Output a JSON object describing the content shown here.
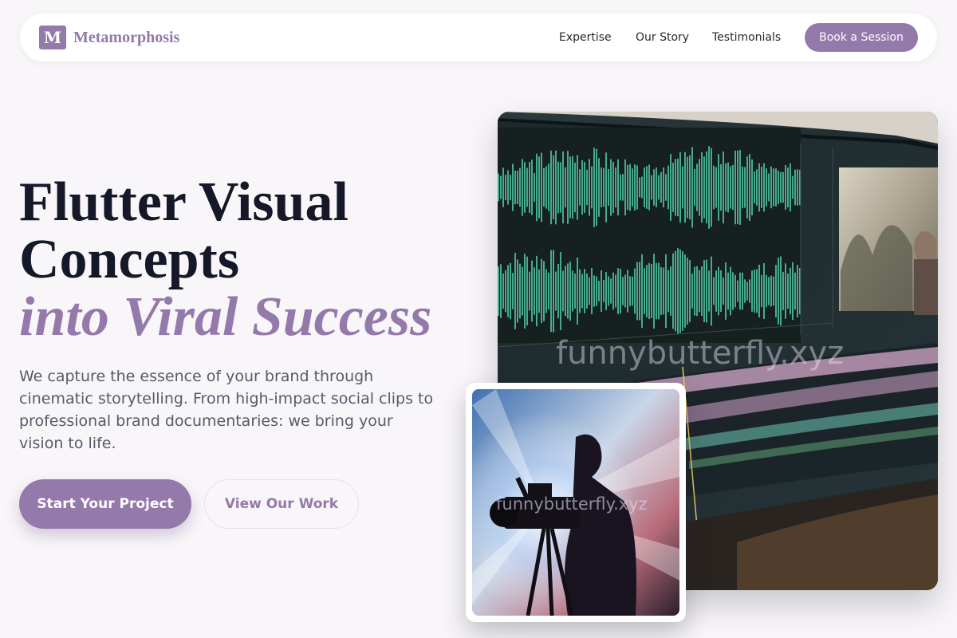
{
  "brand": {
    "logo_letter": "M",
    "name": "Metamorphosis",
    "accent_color": "#9479ab"
  },
  "nav": {
    "links": [
      "Expertise",
      "Our Story",
      "Testimonials"
    ],
    "cta": "Book a Session"
  },
  "hero": {
    "title_line1": "Flutter Visual",
    "title_line2": "Concepts",
    "title_accent": "into Viral Success",
    "description": "We capture the essence of your brand through cinematic storytelling. From high-impact social clips to professional brand documentaries: we bring your vision to life.",
    "primary_cta": "Start Your Project",
    "secondary_cta": "View Our Work"
  },
  "images": {
    "main": "video-editing-timeline-image",
    "secondary": "cinematographer-camera-image"
  },
  "watermark": "funnybutterfly.xyz"
}
